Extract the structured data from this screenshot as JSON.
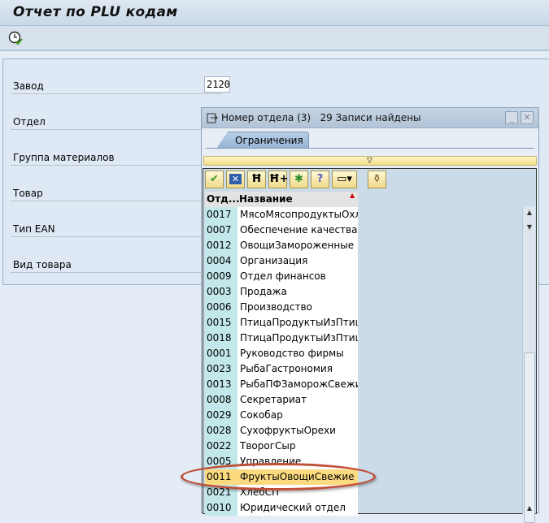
{
  "title": "Отчет по PLU кодам",
  "toolbar": {
    "execute_icon": "clock-execute-icon"
  },
  "fields": [
    {
      "label": "Завод",
      "value": "2120"
    },
    {
      "label": "Отдел",
      "value": ""
    },
    {
      "label": "Группа материалов",
      "value": ""
    },
    {
      "label": "Товар",
      "value": ""
    },
    {
      "label": "Тип EAN",
      "value": ""
    },
    {
      "label": "Вид товара",
      "value": ""
    }
  ],
  "popup": {
    "title": "Номер отдела (3)   29 Записи найдены",
    "tab": "Ограничения",
    "columns": [
      "Отд...",
      "Название"
    ],
    "toolbar_icons": [
      "check-icon",
      "cancel-icon",
      "find-icon",
      "find-next-icon",
      "new-entry-icon",
      "help-icon",
      "print-icon",
      "filter-icon"
    ],
    "rows": [
      {
        "code": "0017",
        "name": "МясоМясопродуктыОхлС"
      },
      {
        "code": "0007",
        "name": "Обеспечение качества"
      },
      {
        "code": "0012",
        "name": "ОвощиЗамороженные"
      },
      {
        "code": "0004",
        "name": "Организация"
      },
      {
        "code": "0009",
        "name": "Отдел финансов"
      },
      {
        "code": "0003",
        "name": "Продажа"
      },
      {
        "code": "0006",
        "name": "Производство"
      },
      {
        "code": "0015",
        "name": "ПтицаПродуктыИзПтицы"
      },
      {
        "code": "0018",
        "name": "ПтицаПродуктыИзПтицы"
      },
      {
        "code": "0001",
        "name": "Руководство фирмы"
      },
      {
        "code": "0023",
        "name": "РыбаГастрономия"
      },
      {
        "code": "0013",
        "name": "РыбаПФЗаморожСвежие"
      },
      {
        "code": "0008",
        "name": "Секретариат"
      },
      {
        "code": "0029",
        "name": "Сокобар"
      },
      {
        "code": "0028",
        "name": "СухофруктыОрехи"
      },
      {
        "code": "0022",
        "name": "ТворогСыр"
      },
      {
        "code": "0005",
        "name": "Управление"
      },
      {
        "code": "0011",
        "name": "ФруктыОвощиСвежие"
      },
      {
        "code": "0021",
        "name": "ХлебСП"
      },
      {
        "code": "0010",
        "name": "Юридический отдел"
      }
    ],
    "selected_code": "0011"
  }
}
